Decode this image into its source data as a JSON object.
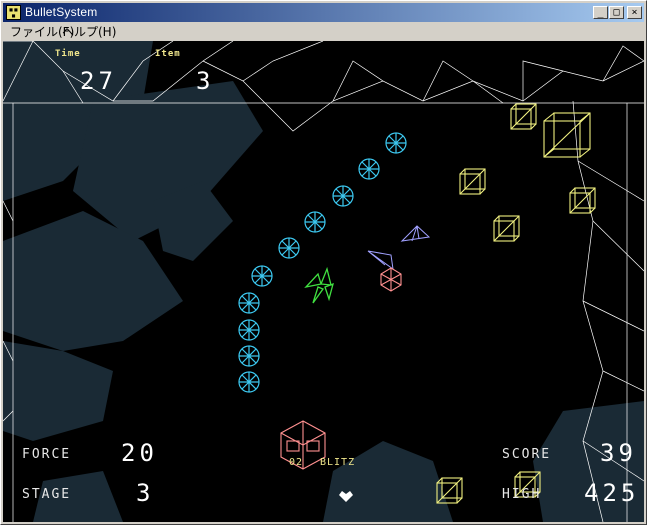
{
  "window": {
    "title": "BulletSystem",
    "icon_name": "app-icon",
    "controls": [
      "minimize-icon",
      "maximize-icon",
      "close-icon"
    ]
  },
  "menu": [
    {
      "label": "ファイル(F)"
    },
    {
      "label": "ヘルプ(H)"
    }
  ],
  "hud": {
    "time_label": "Time",
    "time_value": "27",
    "item_label": "Item",
    "item_value": "3",
    "force_label": "FORCE",
    "force_value": "20",
    "stage_label": "STAGE",
    "stage_value": "3",
    "score_label": "SCORE",
    "score_value": "39",
    "high_label": "HIGH",
    "high_value": "425",
    "weapon_level": "02",
    "weapon_name": "BLITZ"
  },
  "colors": {
    "bullet": "#3cc8f0",
    "crate": "#f0f080",
    "player": "#40e040",
    "enemy_pink": "#ff9090",
    "enemy_violet": "#a0a0ff",
    "terrain": "#1b2b36",
    "wireframe": "#ffffff"
  }
}
